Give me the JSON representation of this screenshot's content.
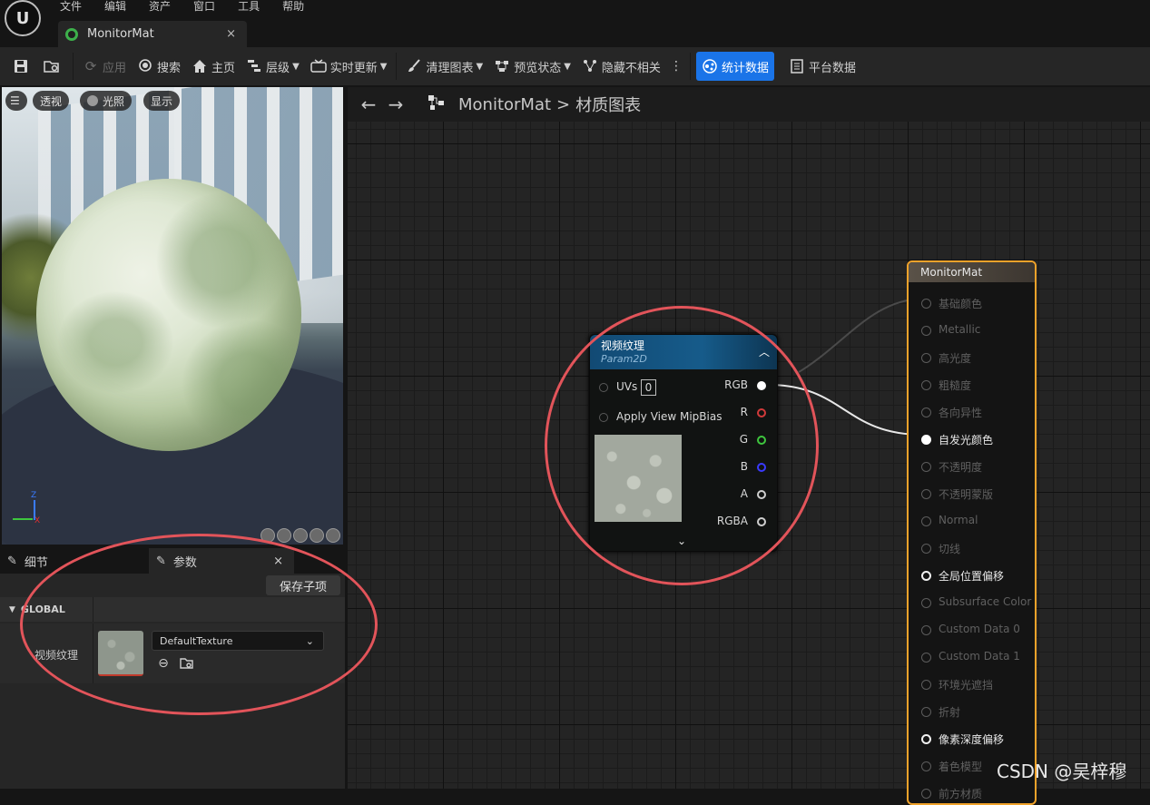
{
  "menu": {
    "items": [
      "文件",
      "编辑",
      "资产",
      "窗口",
      "工具",
      "帮助"
    ]
  },
  "tab": {
    "title": "MonitorMat",
    "close": "×"
  },
  "toolbar": {
    "apply": "应用",
    "search": "搜索",
    "home": "主页",
    "hierarchy": "层级",
    "live_update": "实时更新",
    "clean_graph": "清理图表",
    "preview_state": "预览状态",
    "hide_unrelated": "隐藏不相关",
    "stats": "统计数据",
    "platform_stats": "平台数据"
  },
  "viewport": {
    "btn_perspective": "透视",
    "btn_lit": "光照",
    "btn_show": "显示",
    "axis_z": "Z",
    "axis_x": "X"
  },
  "panels": {
    "details_tab": "细节",
    "params_tab": "参数",
    "close": "×",
    "save_child": "保存子项",
    "group": "GLOBAL",
    "param_label": "视频纹理",
    "texture_value": "DefaultTexture"
  },
  "graph": {
    "breadcrumb_asset": "MonitorMat",
    "breadcrumb_sep": ">",
    "breadcrumb_graph": "材质图表"
  },
  "tex_node": {
    "title": "视频纹理",
    "subtitle": "Param2D",
    "input_uvs": "UVs",
    "uvs_value": "0",
    "input_mipbias": "Apply View MipBias",
    "outputs": [
      "RGB",
      "R",
      "G",
      "B",
      "A",
      "RGBA"
    ]
  },
  "mat_node": {
    "title": "MonitorMat",
    "pins": [
      {
        "label": "基础颜色",
        "active": false
      },
      {
        "label": "Metallic",
        "active": false
      },
      {
        "label": "高光度",
        "active": false
      },
      {
        "label": "粗糙度",
        "active": false
      },
      {
        "label": "各向异性",
        "active": false
      },
      {
        "label": "自发光颜色",
        "active": true
      },
      {
        "label": "不透明度",
        "active": false
      },
      {
        "label": "不透明蒙版",
        "active": false
      },
      {
        "label": "Normal",
        "active": false
      },
      {
        "label": "切线",
        "active": false
      },
      {
        "label": "全局位置偏移",
        "active": true
      },
      {
        "label": "Subsurface Color",
        "active": false
      },
      {
        "label": "Custom Data 0",
        "active": false
      },
      {
        "label": "Custom Data 1",
        "active": false
      },
      {
        "label": "环境光遮挡",
        "active": false
      },
      {
        "label": "折射",
        "active": false
      },
      {
        "label": "像素深度偏移",
        "active": true
      },
      {
        "label": "着色模型",
        "active": false
      },
      {
        "label": "前方材质",
        "active": false
      }
    ]
  },
  "watermark": "CSDN @吴梓穆",
  "colors": {
    "accent": "#1a74e8",
    "result_border": "#f0a22a",
    "annotation": "#e2545a",
    "tex_header": "#165b8a"
  }
}
